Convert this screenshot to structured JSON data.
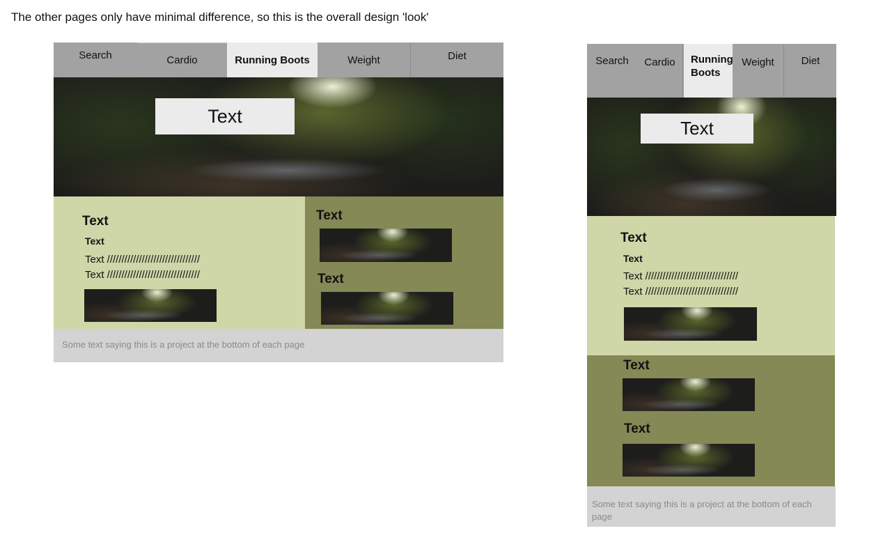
{
  "note": "The other pages only have minimal difference, so this is the overall design 'look'",
  "desktop": {
    "nav": {
      "search": "Search",
      "cardio": "Cardio",
      "running": "Running Boots",
      "weight": "Weight",
      "diet": "Diet"
    },
    "hero_text": "Text",
    "left": {
      "heading": "Text",
      "subheading": "Text",
      "line1": "Text ////////////////////////////////",
      "line2": "Text ////////////////////////////////"
    },
    "right": {
      "heading1": "Text",
      "heading2": "Text"
    },
    "footer": "Some text saying this is a project at the bottom of each page"
  },
  "mobile": {
    "nav": {
      "search": "Search",
      "cardio": "Cardio",
      "running_line1": "Running",
      "running_line2": "Boots",
      "weight": "Weight",
      "diet": "Diet"
    },
    "hero_text": "Text",
    "light": {
      "heading": "Text",
      "subheading": "Text",
      "line1": "Text ////////////////////////////////",
      "line2": "Text ////////////////////////////////"
    },
    "dark": {
      "heading1": "Text",
      "heading2": "Text"
    },
    "footer": "Some text saying this is a project at the bottom of each page"
  },
  "colors": {
    "nav_bg": "#a2a2a2",
    "active_tab": "#ebebeb",
    "light_green": "#cfd6a8",
    "dark_green": "#848955",
    "footer_bg": "#d3d3d3"
  }
}
